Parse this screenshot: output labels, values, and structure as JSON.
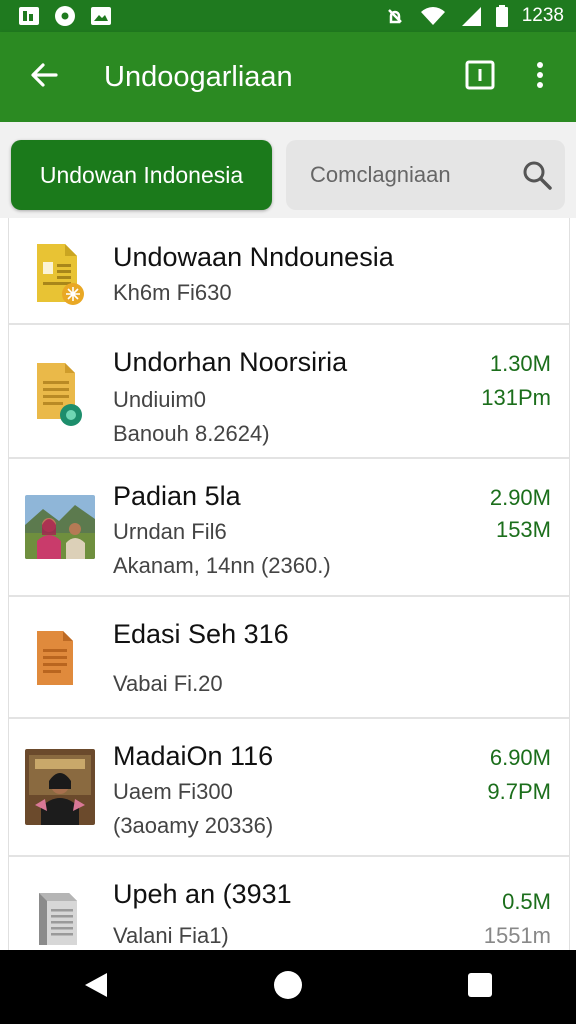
{
  "status_bar": {
    "time": "1238",
    "icons": [
      "notification-app-icon",
      "notification-dot-icon",
      "image-icon",
      "no-alarm-icon",
      "wifi-icon",
      "signal-icon",
      "battery-icon"
    ]
  },
  "app_bar": {
    "title": "Undoogarliaan",
    "icons": [
      "back-arrow-icon",
      "info-icon",
      "more-vert-icon"
    ]
  },
  "filter": {
    "primary_label": "Undowan Indonesia",
    "search_placeholder": "Comclagniaan"
  },
  "files": [
    {
      "title": "Undowaan Nndounesia",
      "subtitle": "Kh6m Fi630",
      "date": "",
      "size": "",
      "time": "",
      "icon": "yellow-document-icon"
    },
    {
      "title": "Undorhan Noorsiria",
      "subtitle": "Undiuim0",
      "date": "Banouh 8.2624)",
      "size": "1.30M",
      "time": "131Pm",
      "icon": "yellow-document-badge-icon"
    },
    {
      "title": "Padian 5la",
      "subtitle": "Urndan Fil6",
      "date": "Akanam, 14nn (2360.)",
      "size": "2.90M",
      "time": "153M",
      "icon": "photo-thumbnail"
    },
    {
      "title": "Edasi Seh 316",
      "subtitle": "Vabai Fi.20",
      "date": "",
      "size": "",
      "time": "",
      "icon": "orange-document-icon"
    },
    {
      "title": "MadaiOn 116",
      "subtitle": "Uaem Fi300",
      "date": "(3aoamy 20336)",
      "size": "6.90M",
      "time": "9.7PM",
      "icon": "portrait-thumbnail"
    },
    {
      "title": "Upeh an (3931",
      "subtitle": "Valani Fia1)",
      "date": "",
      "size": "0.5M",
      "time": "1551m",
      "icon": "gray-document-icon"
    }
  ],
  "colors": {
    "status_bar": "#1f7a1f",
    "app_bar": "#2b8a22",
    "primary_button": "#1b7a1b",
    "accent_text": "#1b6e1b"
  }
}
